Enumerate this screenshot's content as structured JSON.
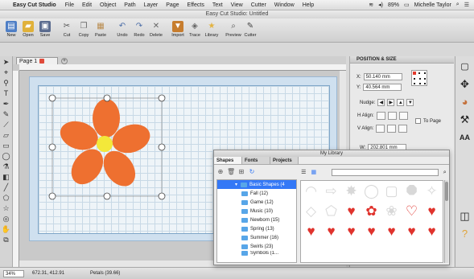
{
  "menubar": {
    "apple": "",
    "app_name": "Easy Cut Studio",
    "items": [
      "File",
      "Edit",
      "Object",
      "Path",
      "Layer",
      "Page",
      "Effects",
      "Text",
      "View",
      "Cutter",
      "Window",
      "Help"
    ],
    "battery": "89%",
    "user": "Michelle Taylor"
  },
  "window_title": "Easy Cut Studio: Untitled",
  "toolbar": {
    "items": [
      {
        "label": "New",
        "icon": "new-file-icon",
        "color": "#4f7fc6"
      },
      {
        "label": "Open",
        "icon": "open-folder-icon",
        "color": "#e0b13a"
      },
      {
        "label": "Save",
        "icon": "save-icon",
        "color": "#5b6c8f"
      },
      {
        "label": "Cut",
        "icon": "scissors-icon",
        "color": "#666666"
      },
      {
        "label": "Copy",
        "icon": "copy-icon",
        "color": "#777777"
      },
      {
        "label": "Paste",
        "icon": "paste-icon",
        "color": "#b98b4d"
      },
      {
        "label": "Undo",
        "icon": "undo-icon",
        "color": "#4c6ea8"
      },
      {
        "label": "Redo",
        "icon": "redo-icon",
        "color": "#4c6ea8"
      },
      {
        "label": "Delete",
        "icon": "delete-icon",
        "color": "#666666"
      },
      {
        "label": "Import",
        "icon": "import-icon",
        "color": "#c77d2e"
      },
      {
        "label": "Trace",
        "icon": "trace-icon",
        "color": "#7a7a7a"
      },
      {
        "label": "Library",
        "icon": "library-icon",
        "color": "#e3b341"
      },
      {
        "label": "Preview",
        "icon": "preview-icon",
        "color": "#555555"
      },
      {
        "label": "Cutter",
        "icon": "cutter-icon",
        "color": "#444444"
      }
    ]
  },
  "doc_tab": {
    "label": "Page 1"
  },
  "canvas": {
    "flower_color": "#ee7030",
    "center_color": "#f3e83a"
  },
  "statusbar": {
    "zoom": "34%",
    "coords": "672.31, 412.91",
    "selection": "Petals (39.66)"
  },
  "position_panel": {
    "title": "POSITION & SIZE",
    "x_label": "X:",
    "x_value": "50.140 mm",
    "y_label": "Y:",
    "y_value": "40.564 mm",
    "nudge_label": "Nudge:",
    "h_align_label": "H Align:",
    "v_align_label": "V Align:",
    "to_page_label": "To Page",
    "w_label": "W:",
    "w_value": "202.801 mm"
  },
  "library": {
    "title": "My Library",
    "tabs": [
      "Shapes",
      "Fonts",
      "Projects"
    ],
    "tree": [
      "Basic Shapes (4",
      "Fall (12)",
      "Game (12)",
      "Music (10)",
      "Newborn (15)",
      "Spring (13)",
      "Summer (16)",
      "Swirls (23)"
    ],
    "tree_partial": "Symbols (1..."
  }
}
